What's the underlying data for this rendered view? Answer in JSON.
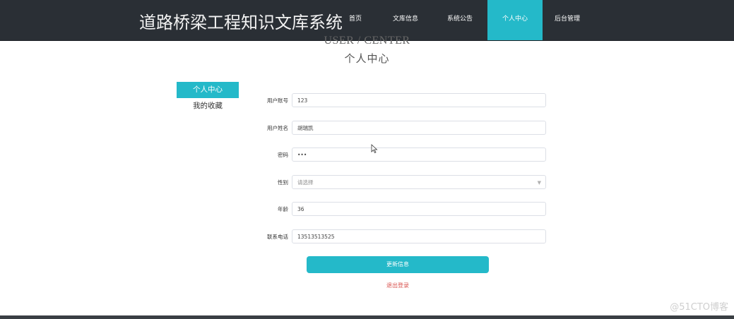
{
  "header": {
    "site_title": "道路桥梁工程知识文库系统",
    "nav": [
      {
        "label": "首页",
        "active": false
      },
      {
        "label": "文库信息",
        "active": false
      },
      {
        "label": "系统公告",
        "active": false
      },
      {
        "label": "个人中心",
        "active": true
      },
      {
        "label": "后台管理",
        "active": false
      }
    ]
  },
  "hero": {
    "en_title": "USER / CENTER",
    "cn_title": "个人中心"
  },
  "sidebar": {
    "items": [
      {
        "label": "个人中心",
        "active": true
      },
      {
        "label": "我的收藏",
        "active": false
      }
    ]
  },
  "form": {
    "account": {
      "label": "用户账号",
      "value": "123"
    },
    "name": {
      "label": "用户姓名",
      "value": "胡瑞凯"
    },
    "password": {
      "label": "密码",
      "value": "•••"
    },
    "gender": {
      "label": "性别",
      "placeholder": "请选择"
    },
    "age": {
      "label": "年龄",
      "value": "36"
    },
    "phone": {
      "label": "联系电话",
      "value": "13513513525"
    },
    "update_button": "更新信息",
    "logout_link": "退出登录"
  },
  "watermark": "@51CTO博客",
  "colors": {
    "accent": "#24b9c9",
    "header_bg": "#2a2f35",
    "logout": "#d9534f"
  }
}
